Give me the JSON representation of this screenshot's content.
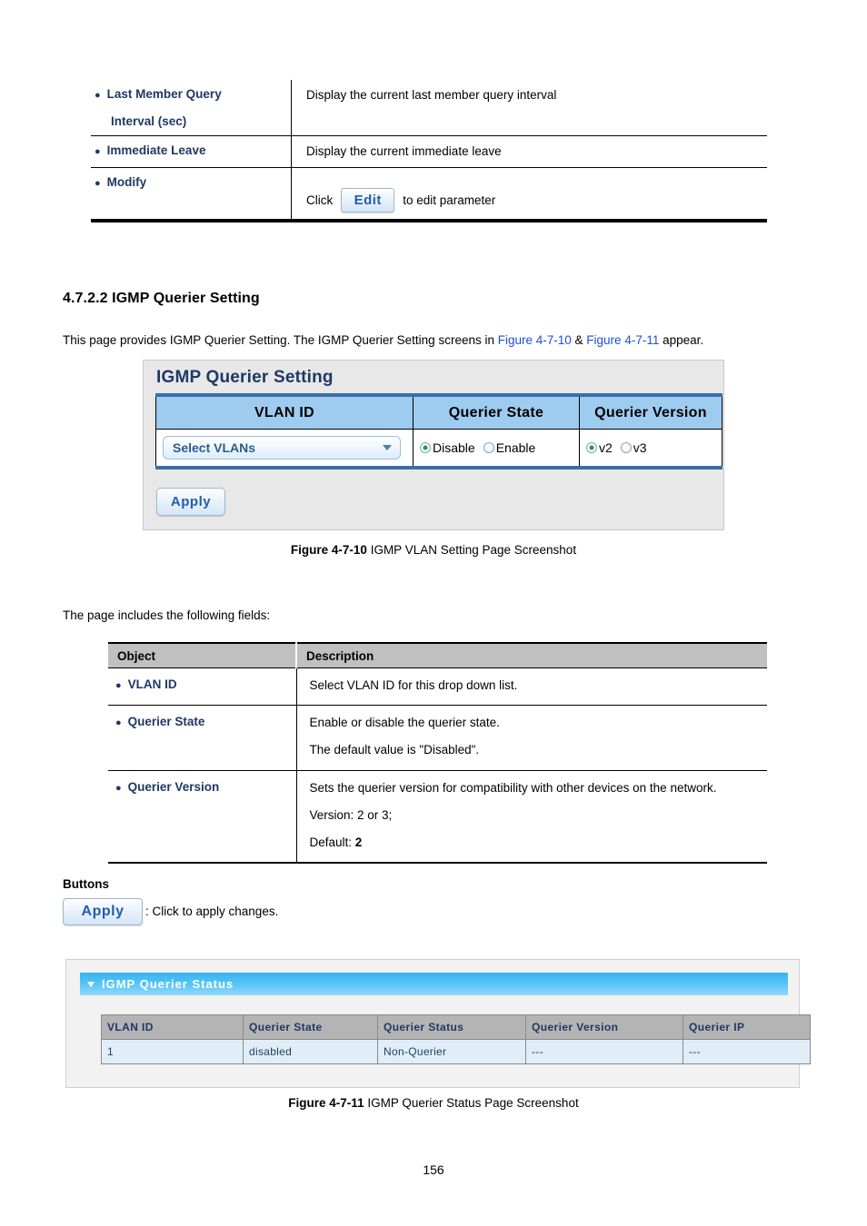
{
  "continued_table": {
    "rows": [
      {
        "object_lines": [
          "Last Member Query",
          "Interval (sec)"
        ],
        "description": "Display the current last member query interval"
      },
      {
        "object_lines": [
          "Immediate Leave"
        ],
        "description": "Display the current immediate leave"
      },
      {
        "object_lines": [
          "Modify"
        ],
        "click_prefix": "Click",
        "edit_button_label": "Edit",
        "click_suffix": "to edit parameter"
      }
    ]
  },
  "section": {
    "heading": "4.7.2.2 IGMP Querier Setting",
    "intro_part1": "This page provides IGMP Querier Setting. The IGMP Querier Setting screens in ",
    "intro_xref1": "Figure 4-7-10",
    "intro_amp": " & ",
    "intro_xref2": "Figure 4-7-11",
    "intro_part2": " appear."
  },
  "figure_setting": {
    "panel_title": "IGMP Querier Setting",
    "headers": [
      "VLAN ID",
      "Querier State",
      "Querier Version"
    ],
    "vlan_dropdown_value": "Select VLANs",
    "querier_state": {
      "options": [
        {
          "label": "Disable",
          "checked": true
        },
        {
          "label": "Enable",
          "checked": false
        }
      ]
    },
    "querier_version": {
      "options": [
        {
          "label": "v2",
          "checked": true
        },
        {
          "label": "v3",
          "checked": false
        }
      ]
    },
    "apply_label": "Apply",
    "caption_bold": "Figure 4-7-10",
    "caption_rest": " IGMP VLAN Setting Page Screenshot"
  },
  "fields_intro": "The page includes the following fields:",
  "object_table": {
    "headers": {
      "object": "Object",
      "description": "Description"
    },
    "rows": [
      {
        "object": "VLAN ID",
        "desc_lines": [
          "Select VLAN ID for this drop down list."
        ]
      },
      {
        "object": "Querier State",
        "desc_lines": [
          "Enable or disable the querier state.",
          "The default value is \"Disabled\"."
        ]
      },
      {
        "object": "Querier Version",
        "desc_lines": [
          "Sets the querier version for compatibility with other devices on the network.",
          "Version: 2 or 3;",
          "Default: 2"
        ],
        "desc_last_bold_tail": "2"
      }
    ]
  },
  "buttons_section": {
    "heading": "Buttons",
    "apply_label": "Apply",
    "caption": ": Click to apply changes."
  },
  "figure_status": {
    "panel_title": "IGMP Querier Status",
    "headers": [
      "VLAN ID",
      "Querier State",
      "Querier Status",
      "Querier Version",
      "Querier IP"
    ],
    "rows": [
      [
        "1",
        "disabled",
        "Non-Querier",
        "---",
        "---"
      ]
    ],
    "caption_bold": "Figure 4-7-11",
    "caption_rest": " IGMP Querier Status Page Screenshot"
  },
  "page_number": "156",
  "colors": {
    "object_label": "#1F3864",
    "xref_link": "#1F4FD8",
    "table_header_gray": "#C0C0C0",
    "setting_header_blue": "#9ECBF0",
    "status_header_cyan": "#53C3F5",
    "status_cell_blue": "#E1EEF8",
    "radio_checked_green": "#2C9B2C"
  }
}
